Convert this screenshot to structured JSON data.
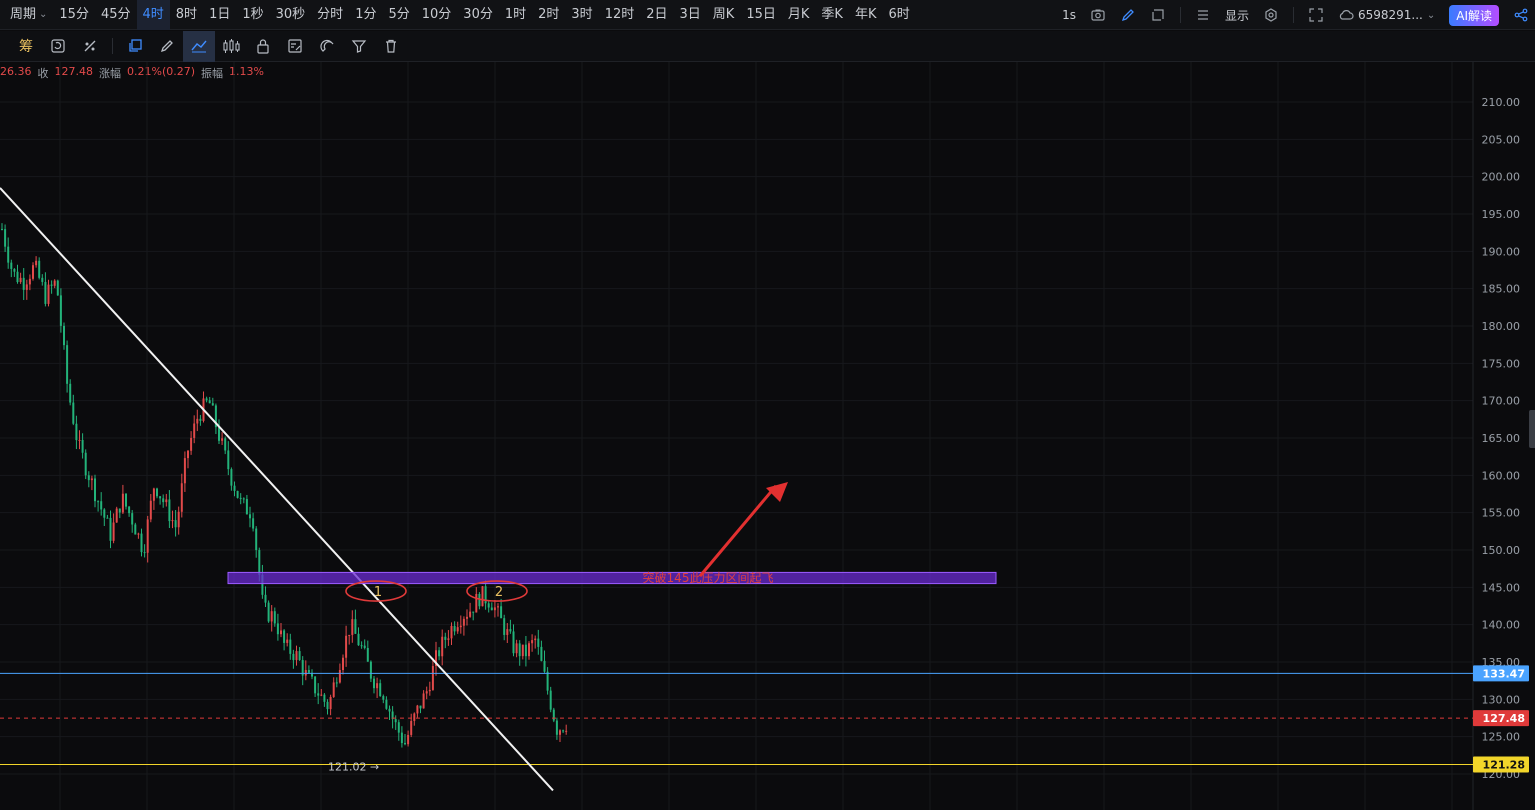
{
  "topbar": {
    "period_label": "周期",
    "timeframes": [
      "15分",
      "45分",
      "4时",
      "8时",
      "1日",
      "1秒",
      "30秒",
      "分时",
      "1分",
      "5分",
      "10分",
      "30分",
      "1时",
      "2时",
      "3时",
      "12时",
      "2日",
      "3日",
      "周K",
      "15日",
      "月K",
      "季K",
      "年K",
      "6时"
    ],
    "active_timeframe": "4时",
    "refresh_label": "1s",
    "display_label": "显示",
    "account_label": "6598291...",
    "ai_label": "AI解读"
  },
  "toolbar": {
    "chip_label": "筹",
    "tools": [
      "cycle-icon",
      "eraser-icon",
      "rect-select-icon",
      "pen-icon",
      "trend-tool-icon",
      "candle-icon",
      "lock-icon",
      "ruler-icon",
      "magnet-icon",
      "filter-icon",
      "trash-icon"
    ],
    "active_tool": "trend-tool-icon"
  },
  "info": {
    "open_fragment": "26.36",
    "close_label": "收",
    "close_value": "127.48",
    "change_label": "涨幅",
    "change_value": "0.21%(0.27)",
    "amplitude_label": "振幅",
    "amplitude_value": "1.13%"
  },
  "chart_data": {
    "type": "candlestick",
    "ylim": [
      117.5,
      213
    ],
    "y_ticks": [
      "210.00",
      "205.00",
      "200.00",
      "195.00",
      "190.00",
      "185.00",
      "180.00",
      "175.00",
      "170.00",
      "165.00",
      "160.00",
      "155.00",
      "150.00",
      "145.00",
      "140.00",
      "135.00",
      "130.00",
      "125.00",
      "120.00"
    ],
    "y_tick_values": [
      210,
      205,
      200,
      195,
      190,
      185,
      180,
      175,
      170,
      165,
      160,
      155,
      150,
      145,
      140,
      135,
      130,
      125,
      120
    ],
    "price_path": [
      193,
      187,
      186,
      188,
      184,
      186,
      172,
      164,
      160,
      156,
      152,
      157,
      154,
      150,
      159,
      156,
      153,
      163,
      168,
      170,
      165,
      160,
      156,
      155,
      142,
      141,
      137,
      136,
      133,
      131,
      129,
      135,
      140,
      137,
      133,
      131,
      127,
      124,
      128,
      131,
      136,
      139,
      141,
      142,
      144,
      143,
      140,
      137,
      136,
      138,
      132,
      126,
      127
    ],
    "levels": [
      {
        "name": "blue-level",
        "value": 133.47,
        "label": "133.47",
        "color": "#4aa3ff"
      },
      {
        "name": "last-price",
        "value": 127.48,
        "label": "127.48",
        "color": "#e03a3a"
      },
      {
        "name": "yellow-level",
        "value": 121.28,
        "label": "121.28",
        "color": "#f2d52a"
      }
    ],
    "low_marker": {
      "value": 121.02,
      "label": "121.02 →"
    },
    "zone": {
      "from": 145.5,
      "to": 147.0,
      "label": "突破145此压力区间起飞",
      "color": "#6a2bd0"
    },
    "peaks": [
      {
        "label": "1",
        "value": 144.5
      },
      {
        "label": "2",
        "value": 144.5
      }
    ],
    "up_color": "#e24a4a",
    "down_color": "#23b37a"
  }
}
